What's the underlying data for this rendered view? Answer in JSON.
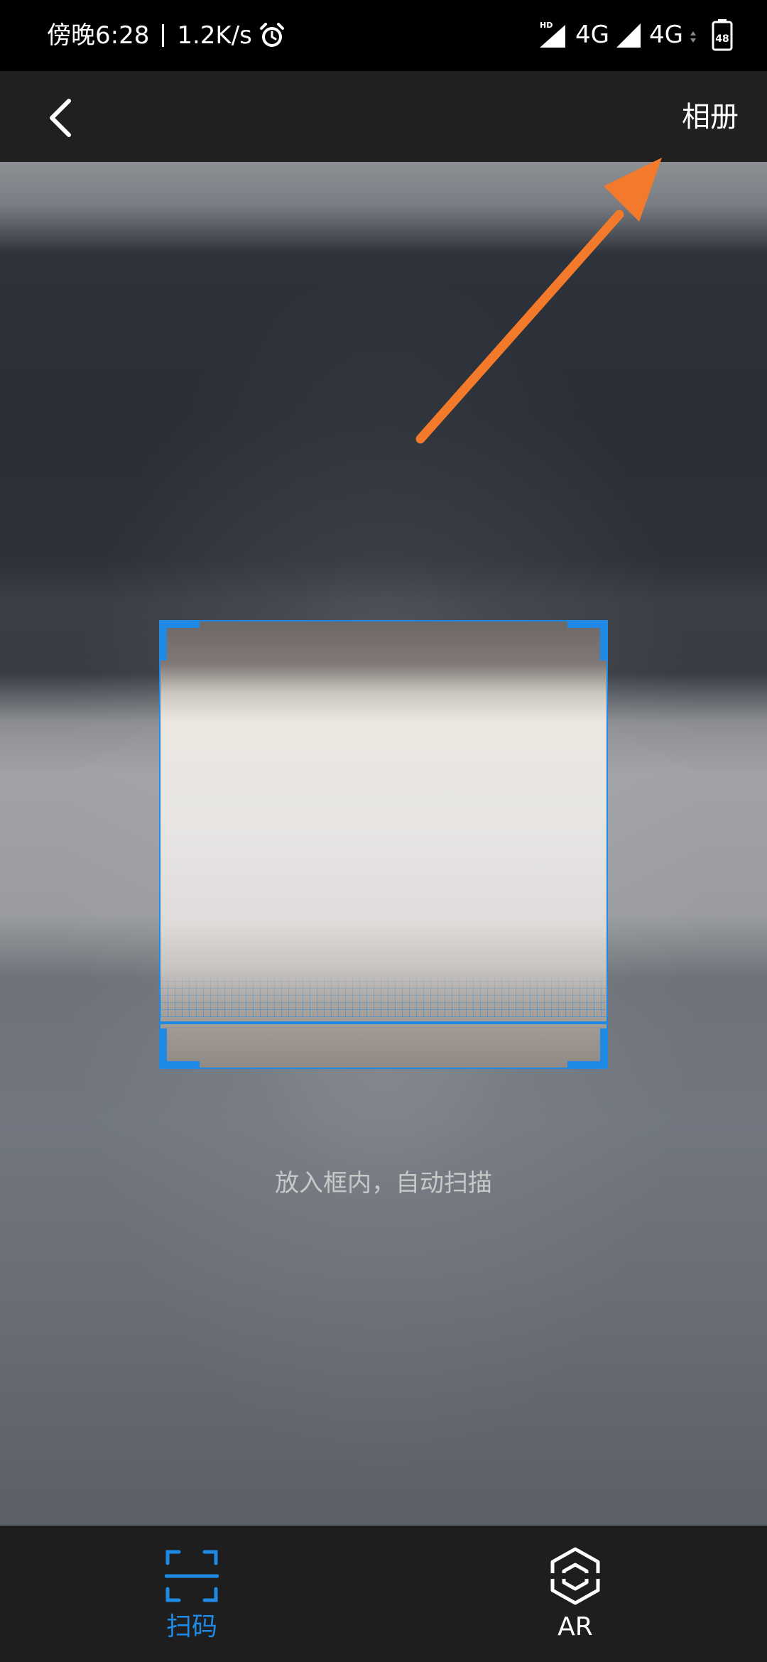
{
  "status_bar": {
    "time": "傍晚6:28",
    "net_speed": "1.2K/s",
    "icons": [
      "alarm-icon",
      "hd-signal-icon",
      "signal-icon",
      "battery-icon"
    ],
    "sim1_network": "4G",
    "sim2_network": "4G",
    "hd_label": "HD",
    "battery_level": "48"
  },
  "top_bar": {
    "back_icon": "chevron-left-icon",
    "album_label": "相册"
  },
  "scanner": {
    "hint": "放入框内，自动扫描",
    "accent_color": "#1f8ae6"
  },
  "annotation": {
    "arrow_color": "#f37a2a",
    "icon": "annotation-arrow-icon"
  },
  "tabs": [
    {
      "label": "扫码",
      "icon": "scan-frame-icon",
      "active": true
    },
    {
      "label": "AR",
      "icon": "ar-hexagon-icon",
      "active": false
    }
  ]
}
